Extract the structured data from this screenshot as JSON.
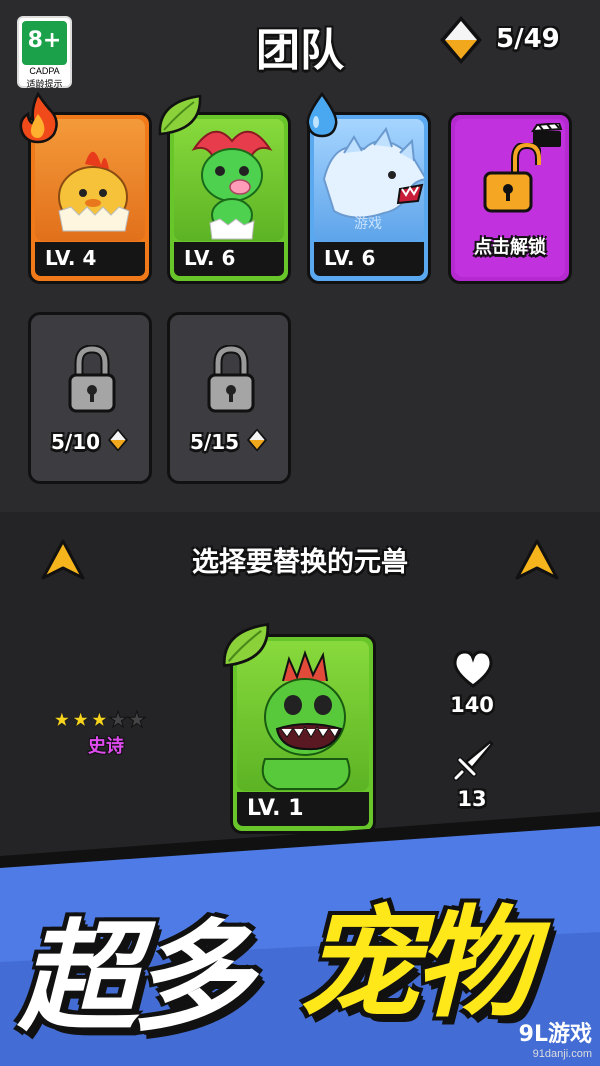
{
  "age_rating": {
    "rating": "8+",
    "org": "CADPA",
    "note": "适龄提示"
  },
  "header": {
    "title": "团队",
    "gem_count": "5/49"
  },
  "team_cards": [
    {
      "level": "LV. 4",
      "element": "fire",
      "color": "#f07a1a"
    },
    {
      "level": "LV. 6",
      "element": "leaf",
      "color": "#69c62a"
    },
    {
      "level": "LV. 6",
      "element": "water",
      "color": "#5aa8f0"
    }
  ],
  "card_watermark": "游戏",
  "unlock_slot": {
    "label": "点击解锁"
  },
  "locked_slots": [
    {
      "requirement": "5/10"
    },
    {
      "requirement": "5/15"
    }
  ],
  "selection": {
    "title": "选择要替换的元兽",
    "stars_filled": 3,
    "stars_total": 5,
    "rarity": "史诗",
    "card_level": "LV. 1",
    "hp": "140",
    "attack": "13"
  },
  "promo": {
    "text_white": "超多",
    "text_yellow": "宠物"
  },
  "watermark": {
    "main": "9L游戏",
    "sub": "91danji.com"
  }
}
